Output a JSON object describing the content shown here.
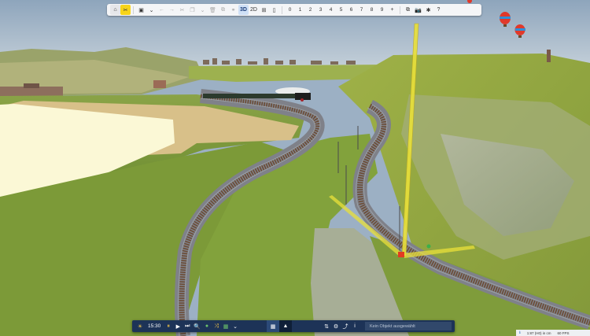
{
  "toolbar": {
    "buttons": [
      {
        "name": "home-button",
        "icon": "home-icon",
        "glyph": "⌂"
      },
      {
        "name": "tools-button",
        "icon": "tools-icon",
        "glyph": "✂"
      },
      {
        "name": "save-button",
        "icon": "save-icon",
        "glyph": "▣"
      },
      {
        "name": "save-menu-button",
        "icon": "chevron-down-icon",
        "glyph": "⌄"
      },
      {
        "name": "undo-button",
        "icon": "undo-icon",
        "glyph": "←"
      },
      {
        "name": "redo-button",
        "icon": "redo-icon",
        "glyph": "→"
      },
      {
        "name": "cut-button",
        "icon": "cut-icon",
        "glyph": "✂"
      },
      {
        "name": "copy-button",
        "icon": "copy-icon",
        "glyph": "❐"
      },
      {
        "name": "paste-button",
        "icon": "paste-icon",
        "glyph": "⌄"
      },
      {
        "name": "delete-button",
        "icon": "trash-icon",
        "glyph": "🗑"
      },
      {
        "name": "duplicate-button",
        "icon": "duplicate-icon",
        "glyph": "⧉"
      },
      {
        "name": "link-button",
        "icon": "link-icon",
        "glyph": "⚭"
      }
    ],
    "view_3d": "3D",
    "view_2d": "2D",
    "grid_glyph": "⊞",
    "page_glyph": "▯",
    "slots": [
      "0",
      "1",
      "2",
      "3",
      "4",
      "5",
      "6",
      "7",
      "8",
      "9"
    ],
    "add_glyph": "+",
    "window_glyph": "⧉",
    "camera_glyph": "📷",
    "puzzle_glyph": "✱",
    "help_glyph": "?"
  },
  "bottombar": {
    "weather_glyph": "☀",
    "time": "15:30",
    "pause_glyph": "⏸",
    "play_glyph": "▶",
    "fast_glyph": "⏭",
    "search_glyph": "🔍",
    "globe_glyph": "●",
    "shuffle_glyph": "⤨",
    "layers_glyph": "▦",
    "layers_menu_glyph": "⌄",
    "view_grid_glyph": "▦",
    "view_terrain_glyph": "▲",
    "sort_glyph": "⇅",
    "settings_glyph": "⚙",
    "tracks_glyph": "⤴",
    "info_glyph": "i",
    "status": "Kein Objekt ausgewählt"
  },
  "statusbar": {
    "info_glyph": "ℹ",
    "scale": "1:87 (H0) in cm",
    "fps": "60 FPS"
  },
  "colors": {
    "toolbar_bg": "#f4f5f7",
    "active_tool": "#f7d419",
    "pressed_view": "#cfe0f6",
    "bottom_bar_bg": "#1d3357",
    "sky": "#9cb0c4",
    "grass": "#8fa83c",
    "gravel": "#7d7f86",
    "rail": "#6b4a32",
    "measure_tool": "#e9e03a"
  }
}
